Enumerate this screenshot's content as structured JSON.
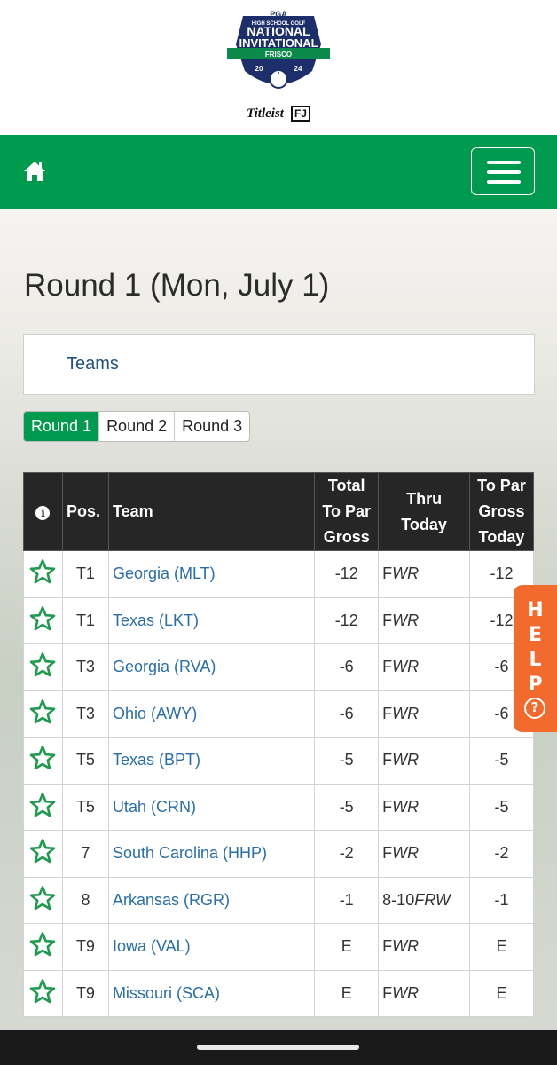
{
  "logo": {
    "pga": "PGA",
    "line1": "HIGH SCHOOL GOLF",
    "line2": "NATIONAL",
    "line3": "INVITATIONAL",
    "ribbon": "FRISCO",
    "year_left": "20",
    "year_right": "24",
    "sponsor_titleist": "Titleist",
    "sponsor_fj": "FJ"
  },
  "colors": {
    "brand_green": "#009a4e",
    "header_dark": "#262626",
    "link_blue": "#2a6ea8",
    "help_orange": "#f26a2e"
  },
  "nav": {
    "home_icon": "home-icon",
    "menu_icon": "hamburger-menu-icon"
  },
  "page": {
    "title": "Round 1 (Mon, July 1)"
  },
  "teams_link": "Teams",
  "rounds": [
    {
      "label": "Round 1",
      "active": true
    },
    {
      "label": "Round 2",
      "active": false
    },
    {
      "label": "Round 3",
      "active": false
    }
  ],
  "table": {
    "headers": {
      "info": "i",
      "pos": "Pos.",
      "team": "Team",
      "total": [
        "Total",
        "To Par",
        "Gross"
      ],
      "thru": [
        "Thru",
        "Today"
      ],
      "today": [
        "To Par",
        "Gross",
        "Today"
      ]
    },
    "rows": [
      {
        "pos": "T1",
        "team": "Georgia (MLT)",
        "total": "-12",
        "thru": "F",
        "thru_suffix": "WR",
        "today": "-12"
      },
      {
        "pos": "T1",
        "team": "Texas (LKT)",
        "total": "-12",
        "thru": "F",
        "thru_suffix": "WR",
        "today": "-12"
      },
      {
        "pos": "T3",
        "team": "Georgia (RVA)",
        "total": "-6",
        "thru": "F",
        "thru_suffix": "WR",
        "today": "-6"
      },
      {
        "pos": "T3",
        "team": "Ohio (AWY)",
        "total": "-6",
        "thru": "F",
        "thru_suffix": "WR",
        "today": "-6"
      },
      {
        "pos": "T5",
        "team": "Texas (BPT)",
        "total": "-5",
        "thru": "F",
        "thru_suffix": "WR",
        "today": "-5"
      },
      {
        "pos": "T5",
        "team": "Utah (CRN)",
        "total": "-5",
        "thru": "F",
        "thru_suffix": "WR",
        "today": "-5"
      },
      {
        "pos": "7",
        "team": "South Carolina (HHP)",
        "total": "-2",
        "thru": "F",
        "thru_suffix": "WR",
        "today": "-2"
      },
      {
        "pos": "8",
        "team": "Arkansas (RGR)",
        "total": "-1",
        "thru": "8-10",
        "thru_suffix": "FRW",
        "today": "-1"
      },
      {
        "pos": "T9",
        "team": "Iowa (VAL)",
        "total": "E",
        "thru": "F",
        "thru_suffix": "WR",
        "today": "E"
      },
      {
        "pos": "T9",
        "team": "Missouri (SCA)",
        "total": "E",
        "thru": "F",
        "thru_suffix": "WR",
        "today": "E"
      }
    ]
  },
  "help": {
    "letters": [
      "H",
      "E",
      "L",
      "P"
    ],
    "icon": "question-circle-icon",
    "glyph": "?"
  }
}
